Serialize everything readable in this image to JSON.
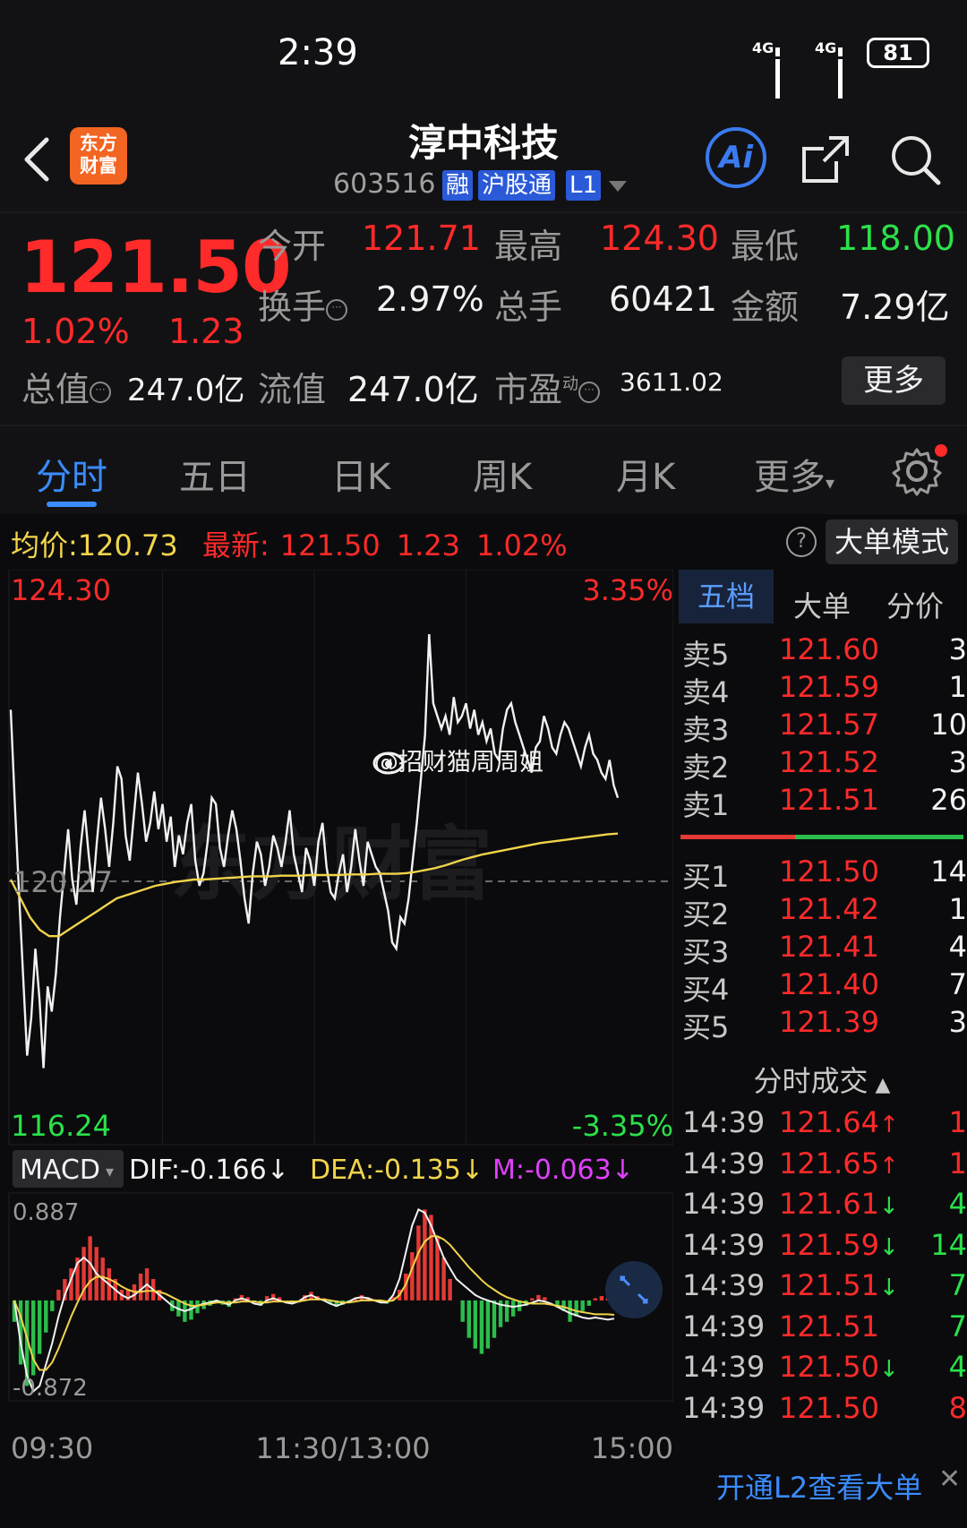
{
  "status": {
    "time": "2:39",
    "net1": "4G",
    "net2": "4G",
    "battery": "81"
  },
  "header": {
    "logo_line1": "东方",
    "logo_line2": "财富",
    "name": "淳中科技",
    "code": "603516",
    "tags": [
      "融",
      "沪股通",
      "L1"
    ],
    "ai_label": "Ai"
  },
  "quote": {
    "price": "121.50",
    "change_pct": "1.02%",
    "change": "1.23",
    "open_label": "今开",
    "open": "121.71",
    "high_label": "最高",
    "high": "124.30",
    "low_label": "最低",
    "low": "118.00",
    "turnover_label": "换手",
    "turnover": "2.97%",
    "volume_label": "总手",
    "volume": "60421",
    "amount_label": "金额",
    "amount": "7.29亿",
    "mktcap_label": "总值",
    "mktcap": "247.0亿",
    "float_label": "流值",
    "float": "247.0亿",
    "pe_label": "市盈",
    "pe_sup": "动",
    "pe": "3611.02",
    "more": "更多"
  },
  "tabs": {
    "items": [
      "分时",
      "五日",
      "日K",
      "周K",
      "月K"
    ],
    "more": "更多"
  },
  "info": {
    "avg_label": "均价:",
    "avg": "120.73",
    "latest_label": "最新:",
    "latest": "121.50",
    "latest_chg": "1.23",
    "latest_pct": "1.02%",
    "help": "?",
    "bigorder": "大单模式"
  },
  "chart_data": {
    "type": "line",
    "title": "",
    "price_max": "124.30",
    "price_min": "116.24",
    "pct_max": "3.35%",
    "pct_min": "-3.35%",
    "prev_close": "120.27",
    "ylim": [
      116.24,
      124.3
    ],
    "x_labels": [
      "09:30",
      "11:30/13:00",
      "15:00"
    ],
    "watermark": "@招财猫周周姐",
    "brand_watermark": "东方财富",
    "series": [
      {
        "color": "#f2f2f2",
        "values": [
          122.7,
          121.2,
          119.8,
          118.5,
          117.2,
          117.8,
          118.9,
          118.1,
          117.0,
          118.3,
          117.9,
          118.5,
          119.4,
          120.1,
          120.8,
          120.0,
          119.6,
          120.5,
          121.1,
          120.4,
          119.8,
          120.6,
          121.3,
          120.8,
          120.2,
          120.9,
          121.8,
          121.6,
          120.7,
          120.3,
          121.0,
          121.7,
          121.2,
          120.6,
          120.9,
          121.4,
          120.8,
          121.2,
          120.6,
          121.0,
          120.2,
          120.7,
          120.4,
          120.9,
          121.2,
          120.3,
          119.9,
          120.1,
          120.6,
          121.3,
          121.2,
          120.5,
          120.2,
          120.7,
          121.1,
          120.8,
          120.3,
          119.7,
          119.3,
          120.1,
          120.6,
          120.4,
          119.9,
          120.2,
          120.7,
          120.5,
          120.2,
          120.6,
          121.1,
          120.4,
          120.1,
          119.8,
          120.5,
          120.3,
          119.9,
          120.6,
          120.9,
          120.2,
          119.8,
          119.7,
          120.1,
          120.4,
          119.8,
          120.2,
          120.8,
          120.3,
          119.9,
          120.6,
          120.4,
          120.2,
          120.1,
          119.8,
          119.5,
          119.0,
          118.9,
          119.4,
          119.3,
          119.7,
          120.3,
          120.9,
          121.6,
          122.3,
          123.9,
          122.8,
          122.6,
          122.4,
          122.6,
          122.3,
          122.9,
          122.5,
          122.6,
          122.8,
          122.4,
          122.7,
          122.3,
          122.5,
          122.2,
          122.4,
          122.0,
          121.9,
          122.4,
          122.7,
          122.8,
          122.5,
          122.3,
          122.1,
          121.9,
          121.7,
          122.1,
          122.2,
          122.6,
          122.4,
          122.1,
          122.0,
          122.3,
          122.5,
          122.4,
          122.2,
          122.0,
          121.8,
          122.1,
          122.3,
          122.0,
          121.9,
          121.7,
          121.6,
          121.9,
          121.5,
          121.3
        ],
        "name": ""
      },
      {
        "color": "#f1d44b",
        "values": [
          120.0,
          119.7,
          119.4,
          119.2,
          119.1,
          119.1,
          119.2,
          119.3,
          119.4,
          119.5,
          119.6,
          119.7,
          119.75,
          119.8,
          119.85,
          119.9,
          119.93,
          119.96,
          119.98,
          120.0,
          120.0,
          120.01,
          120.02,
          120.03,
          120.04,
          120.05,
          120.05,
          120.05,
          120.06,
          120.06,
          120.06,
          120.07,
          120.07,
          120.07,
          120.07,
          120.08,
          120.08,
          120.08,
          120.09,
          120.09,
          120.09,
          120.1,
          120.12,
          120.15,
          120.18,
          120.22,
          120.27,
          120.32,
          120.36,
          120.4,
          120.43,
          120.46,
          120.49,
          120.52,
          120.55,
          120.58,
          120.6,
          120.62,
          120.64,
          120.66,
          120.68,
          120.7,
          120.72,
          120.73
        ],
        "name": ""
      }
    ],
    "macd": {
      "label": "MACD",
      "dif_label": "DIF:",
      "dif": "-0.166",
      "dea_label": "DEA:",
      "dea": "-0.135",
      "m_label": "M:",
      "m": "-0.063",
      "ymax": "0.887",
      "ymin": "-0.872",
      "hist": [
        -0.2,
        -0.6,
        -0.8,
        -0.7,
        -0.5,
        -0.3,
        -0.1,
        0.1,
        0.2,
        0.3,
        0.4,
        0.5,
        0.6,
        0.5,
        0.4,
        0.3,
        0.2,
        0.1,
        0.1,
        0.15,
        0.25,
        0.3,
        0.2,
        0.1,
        0.0,
        -0.1,
        -0.15,
        -0.2,
        -0.18,
        -0.12,
        -0.08,
        -0.05,
        -0.02,
        -0.04,
        -0.06,
        0.02,
        0.05,
        0.03,
        -0.02,
        -0.05,
        0.04,
        0.06,
        0.03,
        0.0,
        -0.03,
        -0.02,
        0.05,
        0.08,
        0.04,
        0.02,
        -0.03,
        -0.06,
        -0.04,
        -0.02,
        0.02,
        0.05,
        0.03,
        0.01,
        -0.02,
        -0.03,
        0.03,
        0.1,
        0.25,
        0.45,
        0.7,
        0.85,
        0.8,
        0.6,
        0.4,
        0.2,
        0.0,
        -0.2,
        -0.35,
        -0.45,
        -0.5,
        -0.45,
        -0.35,
        -0.25,
        -0.2,
        -0.15,
        -0.1,
        -0.05,
        0.02,
        0.05,
        0.03,
        0.0,
        -0.05,
        -0.1,
        -0.2,
        -0.15,
        -0.1,
        -0.05,
        0.02,
        0.04,
        0.02,
        -0.02
      ],
      "dif_line": [
        0.0,
        -0.4,
        -0.7,
        -0.85,
        -0.8,
        -0.6,
        -0.4,
        -0.15,
        0.05,
        0.2,
        0.35,
        0.4,
        0.35,
        0.25,
        0.2,
        0.15,
        0.1,
        0.05,
        0.02,
        0.05,
        0.1,
        0.15,
        0.1,
        0.05,
        0.0,
        -0.05,
        -0.08,
        -0.1,
        -0.08,
        -0.05,
        -0.03,
        -0.02,
        0.0,
        -0.02,
        -0.04,
        0.0,
        0.02,
        0.0,
        -0.03,
        -0.04,
        0.0,
        0.02,
        0.0,
        -0.02,
        -0.03,
        -0.01,
        0.03,
        0.05,
        0.02,
        0.0,
        -0.03,
        -0.05,
        -0.03,
        -0.01,
        0.02,
        0.03,
        0.02,
        0.0,
        -0.02,
        -0.02,
        0.05,
        0.2,
        0.45,
        0.7,
        0.85,
        0.82,
        0.7,
        0.55,
        0.4,
        0.3,
        0.2,
        0.15,
        0.1,
        0.05,
        0.02,
        0.0,
        -0.02,
        -0.04,
        -0.05,
        -0.06,
        -0.05,
        -0.04,
        -0.02,
        0.0,
        -0.01,
        -0.03,
        -0.06,
        -0.09,
        -0.12,
        -0.14,
        -0.16,
        -0.17,
        -0.16,
        -0.17,
        -0.18,
        -0.17
      ],
      "dea_line": [
        0.0,
        -0.15,
        -0.35,
        -0.55,
        -0.65,
        -0.65,
        -0.58,
        -0.45,
        -0.3,
        -0.15,
        -0.02,
        0.1,
        0.18,
        0.22,
        0.22,
        0.2,
        0.17,
        0.13,
        0.1,
        0.08,
        0.08,
        0.09,
        0.09,
        0.08,
        0.06,
        0.03,
        0.0,
        -0.03,
        -0.05,
        -0.05,
        -0.04,
        -0.03,
        -0.02,
        -0.02,
        -0.02,
        -0.02,
        -0.01,
        -0.01,
        -0.01,
        -0.02,
        -0.02,
        -0.01,
        -0.01,
        -0.01,
        -0.01,
        -0.01,
        0.0,
        0.01,
        0.01,
        0.01,
        0.0,
        -0.01,
        -0.02,
        -0.02,
        -0.01,
        0.0,
        0.0,
        0.0,
        0.0,
        -0.01,
        0.0,
        0.05,
        0.15,
        0.3,
        0.45,
        0.55,
        0.6,
        0.6,
        0.57,
        0.52,
        0.45,
        0.38,
        0.31,
        0.25,
        0.19,
        0.14,
        0.1,
        0.06,
        0.03,
        0.01,
        -0.01,
        -0.02,
        -0.03,
        -0.03,
        -0.03,
        -0.04,
        -0.05,
        -0.06,
        -0.08,
        -0.1,
        -0.11,
        -0.12,
        -0.13,
        -0.13,
        -0.13,
        -0.135
      ]
    }
  },
  "book": {
    "tabs": [
      "五档",
      "大单",
      "分价"
    ],
    "asks": [
      {
        "label": "卖5",
        "price": "121.60",
        "vol": "3"
      },
      {
        "label": "卖4",
        "price": "121.59",
        "vol": "1"
      },
      {
        "label": "卖3",
        "price": "121.57",
        "vol": "10"
      },
      {
        "label": "卖2",
        "price": "121.52",
        "vol": "3"
      },
      {
        "label": "卖1",
        "price": "121.51",
        "vol": "26"
      }
    ],
    "bids": [
      {
        "label": "买1",
        "price": "121.50",
        "vol": "14"
      },
      {
        "label": "买2",
        "price": "121.42",
        "vol": "1"
      },
      {
        "label": "买3",
        "price": "121.41",
        "vol": "4"
      },
      {
        "label": "买4",
        "price": "121.40",
        "vol": "7"
      },
      {
        "label": "买5",
        "price": "121.39",
        "vol": "3"
      }
    ],
    "trade_header": "分时成交",
    "trades": [
      {
        "time": "14:39",
        "price": "121.64",
        "dir": "↑",
        "vol": "1",
        "side": "red"
      },
      {
        "time": "14:39",
        "price": "121.65",
        "dir": "↑",
        "vol": "1",
        "side": "red"
      },
      {
        "time": "14:39",
        "price": "121.61",
        "dir": "↓",
        "vol": "4",
        "side": "green"
      },
      {
        "time": "14:39",
        "price": "121.59",
        "dir": "↓",
        "vol": "14",
        "side": "green"
      },
      {
        "time": "14:39",
        "price": "121.51",
        "dir": "↓",
        "vol": "7",
        "side": "green"
      },
      {
        "time": "14:39",
        "price": "121.51",
        "dir": "",
        "vol": "7",
        "side": "green"
      },
      {
        "time": "14:39",
        "price": "121.50",
        "dir": "↓",
        "vol": "4",
        "side": "green"
      },
      {
        "time": "14:39",
        "price": "121.50",
        "dir": "",
        "vol": "8",
        "side": "red"
      }
    ],
    "l2_link": "开通L2查看大单"
  }
}
